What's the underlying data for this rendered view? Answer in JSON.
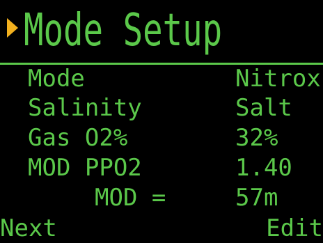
{
  "header": {
    "title": "Mode Setup",
    "cursor_icon": "triangle-right-icon",
    "cursor_color": "#f2b01e",
    "text_color": "#5bc84a"
  },
  "settings": {
    "mode": {
      "label": "Mode",
      "value": "Nitrox"
    },
    "salinity": {
      "label": "Salinity",
      "value": "Salt"
    },
    "gas_o2": {
      "label": "Gas O2%",
      "value": "32%"
    },
    "mod_ppo2": {
      "label": "MOD PPO2",
      "value": "1.40"
    },
    "mod": {
      "label": "MOD =",
      "value": "57m"
    }
  },
  "softkeys": {
    "left": "Next",
    "right": "Edit"
  }
}
